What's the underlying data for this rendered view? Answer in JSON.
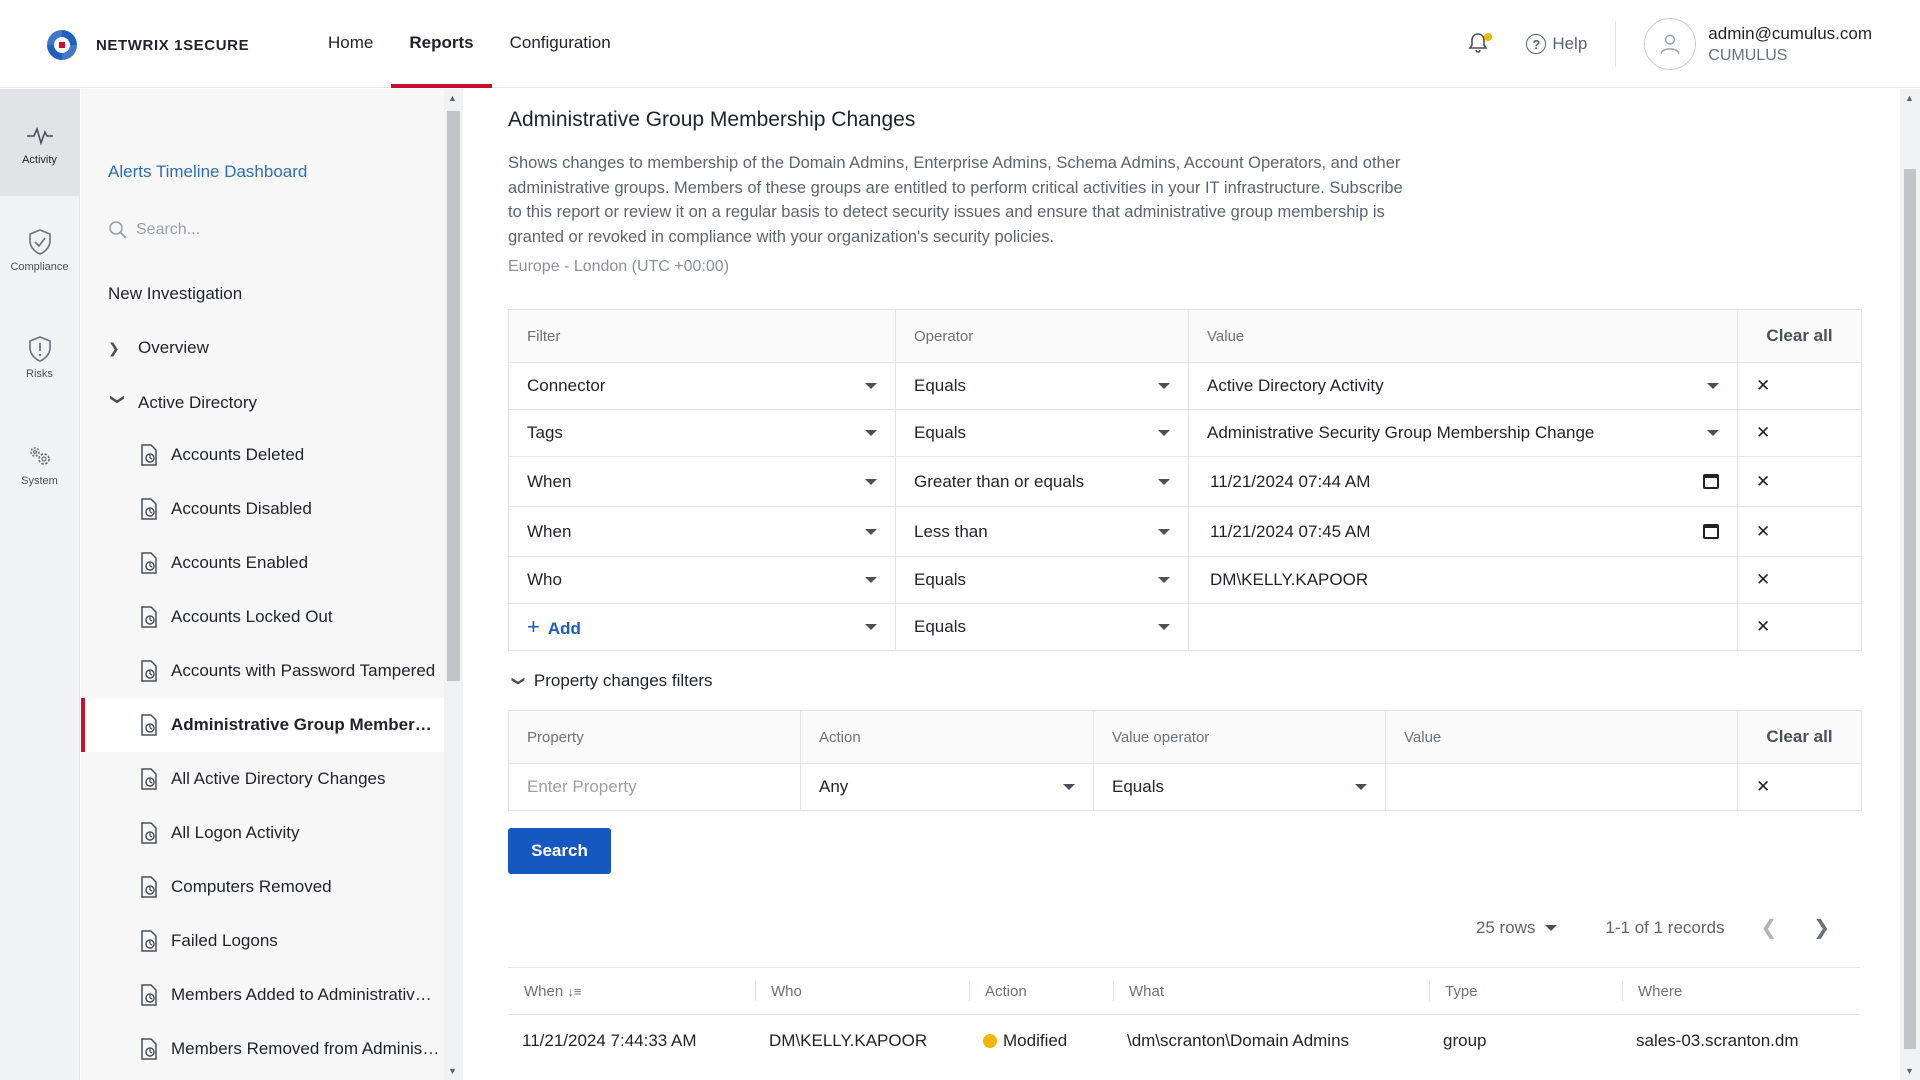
{
  "header": {
    "logo_text": "NETWRIX 1SECURE",
    "nav": [
      {
        "label": "Home",
        "active": false
      },
      {
        "label": "Reports",
        "active": true
      },
      {
        "label": "Configuration",
        "active": false
      }
    ],
    "help_label": "Help",
    "user_email": "admin@cumulus.com",
    "user_org": "CUMULUS",
    "accent_color": "#c8102e",
    "notification_dot_color": "#f2b705"
  },
  "rail": [
    {
      "label": "Activity",
      "icon": "activity-icon",
      "active": true
    },
    {
      "label": "Compliance",
      "icon": "shield-check-icon",
      "active": false
    },
    {
      "label": "Risks",
      "icon": "shield-alert-icon",
      "active": false
    },
    {
      "label": "System",
      "icon": "gears-icon",
      "active": false
    }
  ],
  "sidebar": {
    "dashboard_link": "Alerts Timeline Dashboard",
    "search_placeholder": "Search...",
    "new_investigation": "New Investigation",
    "groups": [
      {
        "label": "Overview",
        "expanded": false
      },
      {
        "label": "Active Directory",
        "expanded": true
      }
    ],
    "items": [
      {
        "label": "Accounts Deleted",
        "active": false
      },
      {
        "label": "Accounts Disabled",
        "active": false
      },
      {
        "label": "Accounts Enabled",
        "active": false
      },
      {
        "label": "Accounts Locked Out",
        "active": false
      },
      {
        "label": "Accounts with Password Tampered",
        "active": false
      },
      {
        "label": "Administrative Group Membershi...",
        "active": true
      },
      {
        "label": "All Active Directory Changes",
        "active": false
      },
      {
        "label": "All Logon Activity",
        "active": false
      },
      {
        "label": "Computers Removed",
        "active": false
      },
      {
        "label": "Failed Logons",
        "active": false
      },
      {
        "label": "Members Added to Administrative ...",
        "active": false
      },
      {
        "label": "Members Removed from Administr...",
        "active": false
      }
    ]
  },
  "report": {
    "title": "Administrative Group Membership Changes",
    "description": "Shows changes to membership of the Domain Admins, Enterprise Admins, Schema Admins, Account Operators, and other administrative groups. Members of these groups are entitled to perform critical activities in your IT infrastructure. Subscribe to this report or review it on a regular basis to detect security issues and ensure that administrative group membership is granted or revoked in compliance with your organization's security policies.",
    "timezone": "Europe - London (UTC +00:00)"
  },
  "filters": {
    "headers": {
      "filter": "Filter",
      "operator": "Operator",
      "value": "Value",
      "clear_all": "Clear all"
    },
    "rows": [
      {
        "filter": "Connector",
        "operator": "Equals",
        "value": "Active Directory Activity"
      },
      {
        "filter": "Tags",
        "operator": "Equals",
        "value": "Administrative Security Group Membership Change"
      },
      {
        "filter": "When",
        "operator": "Greater than or equals",
        "value": "11/21/2024 07:44  AM"
      },
      {
        "filter": "When",
        "operator": "Less than",
        "value": "11/21/2024 07:45  AM"
      },
      {
        "filter": "Who",
        "operator": "Equals",
        "value": "DM\\KELLY.KAPOOR"
      }
    ],
    "add_row": {
      "label": "Add",
      "operator": "Equals",
      "value": ""
    },
    "remove_glyph": "✕"
  },
  "property_filters": {
    "toggle_label": "Property changes filters",
    "headers": {
      "property": "Property",
      "action": "Action",
      "value_operator": "Value operator",
      "value": "Value",
      "clear_all": "Clear all"
    },
    "row": {
      "property_placeholder": "Enter Property",
      "action": "Any",
      "value_operator": "Equals",
      "value": ""
    }
  },
  "search_button": "Search",
  "pager": {
    "rows": "25 rows",
    "records": "1-1 of 1 records"
  },
  "results": {
    "headers": [
      "When",
      "Who",
      "Action",
      "What",
      "Type",
      "Where"
    ],
    "rows": [
      {
        "when": "11/21/2024 7:44:33 AM",
        "who": "DM\\KELLY.KAPOOR",
        "action": "Modified",
        "what": "\\dm\\scranton\\Domain Admins",
        "type": "group",
        "where": "sales-03.scranton.dm"
      }
    ],
    "modified_color": "#f2b705"
  }
}
